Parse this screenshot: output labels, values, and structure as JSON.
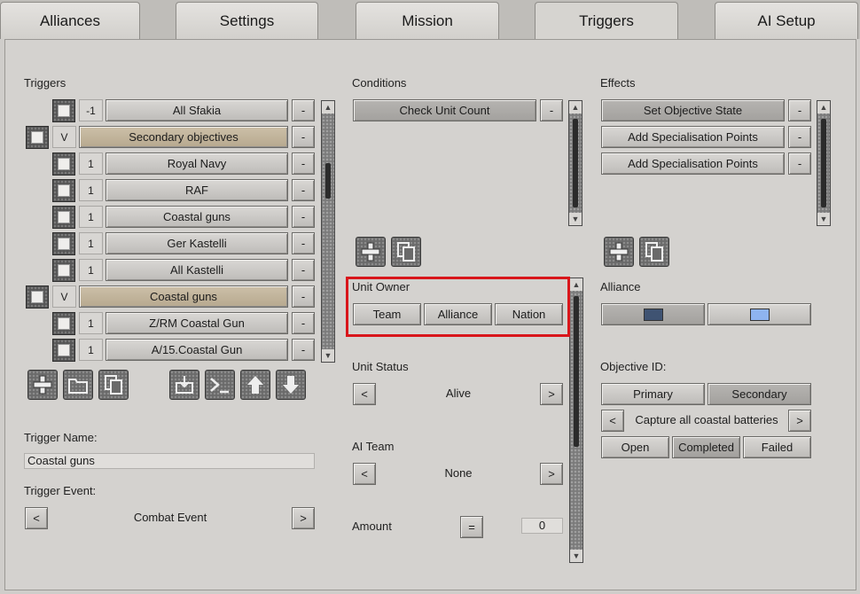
{
  "tabs": [
    "Alliances",
    "Settings",
    "Mission",
    "Triggers",
    "AI Setup"
  ],
  "triggers": {
    "heading": "Triggers",
    "items": [
      {
        "type": "child",
        "num": "-1",
        "label": "All Sfakia"
      },
      {
        "type": "group",
        "num": "V",
        "label": "Secondary objectives"
      },
      {
        "type": "child",
        "num": "1",
        "label": "Royal Navy"
      },
      {
        "type": "child",
        "num": "1",
        "label": "RAF"
      },
      {
        "type": "child",
        "num": "1",
        "label": "Coastal guns"
      },
      {
        "type": "child",
        "num": "1",
        "label": "Ger Kastelli"
      },
      {
        "type": "child",
        "num": "1",
        "label": "All Kastelli"
      },
      {
        "type": "group",
        "num": "V",
        "label": "Coastal guns"
      },
      {
        "type": "child",
        "num": "1",
        "label": "Z/RM Coastal Gun"
      },
      {
        "type": "child",
        "num": "1",
        "label": "A/15.Coastal Gun"
      }
    ],
    "remove_label": "-",
    "trigger_name_label": "Trigger Name:",
    "trigger_name_value": "Coastal guns",
    "trigger_event_label": "Trigger Event:",
    "trigger_event_value": "Combat Event",
    "prev": "<",
    "next": ">"
  },
  "conditions": {
    "heading": "Conditions",
    "items": [
      "Check Unit Count"
    ],
    "unit_owner_label": "Unit Owner",
    "unit_owner_options": [
      "Team",
      "Alliance",
      "Nation"
    ],
    "unit_status_label": "Unit Status",
    "unit_status_value": "Alive",
    "ai_team_label": "AI Team",
    "ai_team_value": "None",
    "amount_label": "Amount",
    "amount_op": "=",
    "amount_value": "0"
  },
  "effects": {
    "heading": "Effects",
    "items": [
      "Set Objective State",
      "Add Specialisation Points",
      "Add Specialisation Points"
    ],
    "alliance_label": "Alliance",
    "alliance_colors": [
      "#3f5372",
      "#8eb4f0"
    ],
    "objective_id_label": "Objective ID:",
    "objective_types": [
      "Primary",
      "Secondary"
    ],
    "objective_value": "Capture all coastal batteries",
    "states": [
      "Open",
      "Completed",
      "Failed"
    ]
  },
  "icons": {
    "add": "add-icon",
    "folder": "folder-icon",
    "copy": "copy-icon",
    "import": "import-icon",
    "console": "console-icon",
    "up": "arrow-up-icon",
    "down": "arrow-down-icon"
  }
}
